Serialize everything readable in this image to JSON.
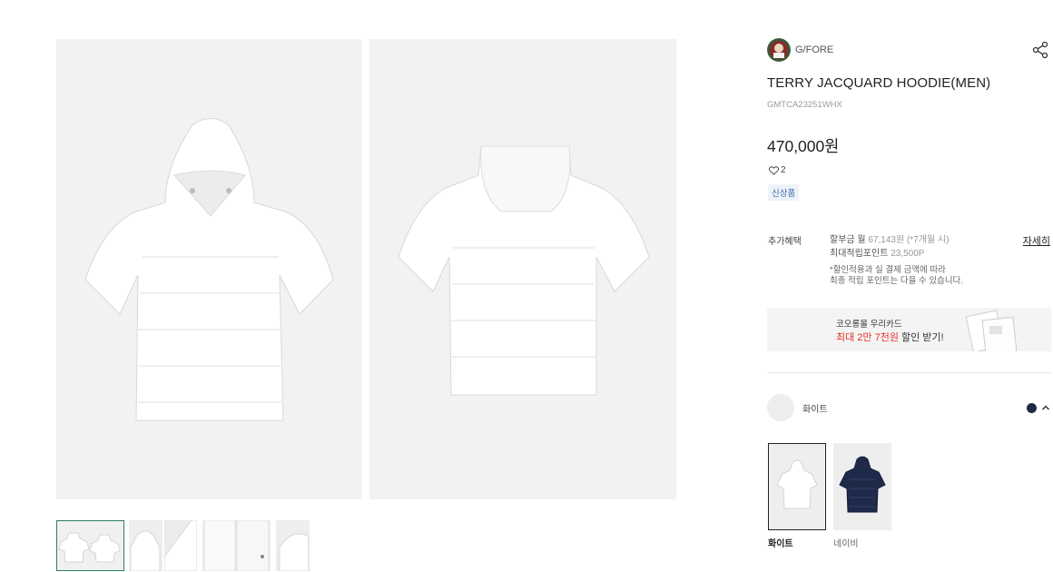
{
  "brand": {
    "name": "G/FORE"
  },
  "product": {
    "title": "TERRY JACQUARD HOODIE(MEN)",
    "code": "GMTCA23251WHX",
    "price": "470,000원",
    "likes": "2",
    "badge": "신상품"
  },
  "benefits": {
    "label": "추가혜택",
    "installment_prefix": "할부금 월",
    "installment_amount": "67,143원 (*7개월 시)",
    "points_prefix": "최대적립포인트",
    "points_amount": "23,500P",
    "note_line1": "*할인적용과 실 결제 금액에 따라",
    "note_line2": "최종 적립 포인트는 다을 수 있습니다.",
    "detail_link": "자세히"
  },
  "card_promo": {
    "line1": "코오롱몰 우리카드",
    "highlight": "최대 2만 7천원",
    "suffix": "할인 받기!"
  },
  "color_option": {
    "selected_label": "화이트",
    "variants": [
      {
        "label": "화이트",
        "color": "#f4f4f4"
      },
      {
        "label": "네이비",
        "color": "#1f2a4a"
      }
    ]
  },
  "colors": {
    "navy": "#1f2a44",
    "promo_red": "#e5322d",
    "badge_blue": "#3b6aa8",
    "thumb_active": "#2e7d5b"
  }
}
